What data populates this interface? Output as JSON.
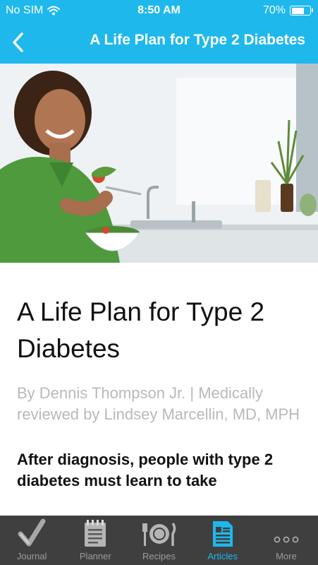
{
  "status_bar": {
    "carrier": "No SIM",
    "time": "8:50 AM",
    "battery_percent": "70%",
    "battery_level": 0.7,
    "wifi_icon": "wifi-icon"
  },
  "nav": {
    "title": "A Life Plan for Type 2 Diabetes",
    "back_icon": "chevron-left-icon"
  },
  "article": {
    "title": "A Life Plan for Type 2 Diabetes",
    "byline": "By Dennis Thompson Jr. | Medically reviewed by Lindsey Marcellin, MD, MPH",
    "lead": "After diagnosis, people with type 2 diabetes must learn to take"
  },
  "tabs": [
    {
      "label": "Journal",
      "icon": "journal-check-icon",
      "active": false
    },
    {
      "label": "Planner",
      "icon": "planner-notepad-icon",
      "active": false
    },
    {
      "label": "Recipes",
      "icon": "plate-utensils-icon",
      "active": false
    },
    {
      "label": "Articles",
      "icon": "articles-document-icon",
      "active": true
    },
    {
      "label": "More",
      "icon": "more-dots-icon",
      "active": false
    }
  ],
  "colors": {
    "accent": "#1eb8ec",
    "tab_bar": "#3f3f3f",
    "tab_inactive": "#9c9c9c",
    "byline": "#b9b9b9"
  }
}
